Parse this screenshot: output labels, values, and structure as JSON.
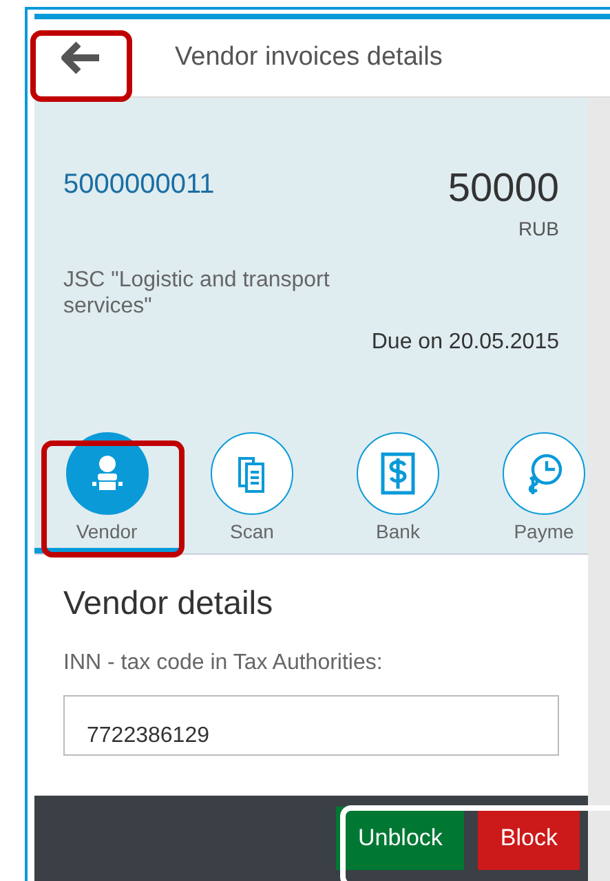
{
  "header": {
    "title": "Vendor invoices details"
  },
  "invoice": {
    "number": "5000000011",
    "amount": "50000",
    "currency": "RUB",
    "vendor": "JSC \"Logistic and transport services\"",
    "due": "Due on 20.05.2015"
  },
  "tabs": [
    {
      "kind": "vendor",
      "label": "Vendor",
      "selected": true
    },
    {
      "kind": "scan",
      "label": "Scan",
      "selected": false
    },
    {
      "kind": "bank",
      "label": "Bank",
      "selected": false
    },
    {
      "kind": "payment",
      "label": "Payme",
      "selected": false
    }
  ],
  "section": {
    "title": "Vendor details",
    "field_label": "INN - tax code in Tax Authorities:",
    "field_value": "7722386129"
  },
  "actions": [
    {
      "kind": "accept",
      "label": "Unblock"
    },
    {
      "kind": "reject",
      "label": "Block"
    }
  ]
}
